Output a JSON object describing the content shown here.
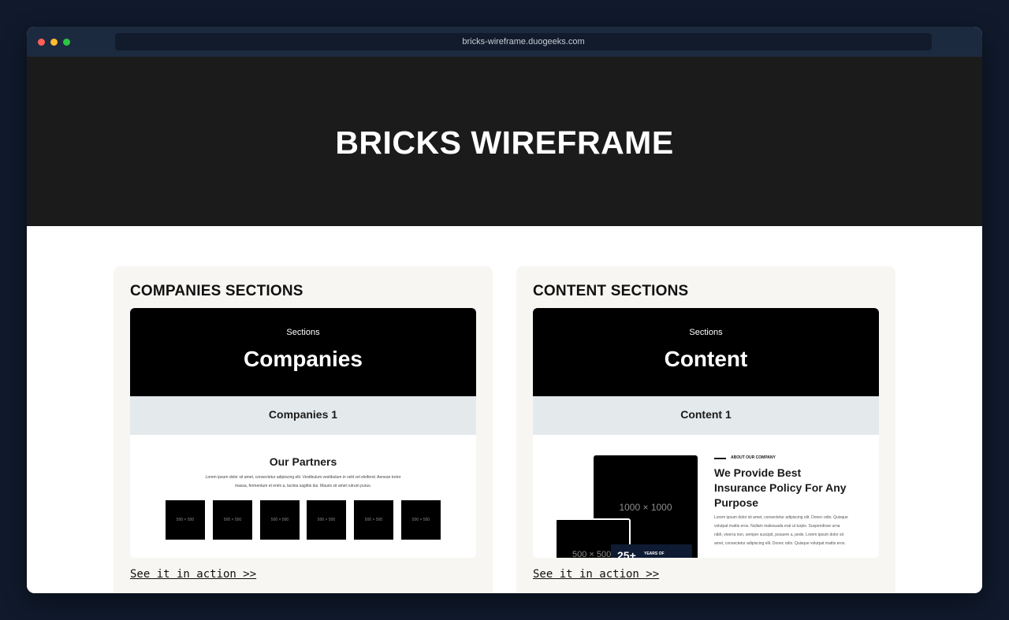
{
  "browser": {
    "url": "bricks-wireframe.duogeeks.com"
  },
  "hero": {
    "title": "BRICKS WIREFRAME"
  },
  "cards": [
    {
      "title": "COMPANIES SECTIONS",
      "preview": {
        "kicker": "Sections",
        "heading": "Companies",
        "band_label": "Companies 1",
        "body_title": "Our Partners",
        "body_text": "Lorem ipsum dolor sit amet, consectetur adipiscing elit. Vestibulum vestibulum in velit vel eleifend. Aenean tortor massa, fermentum et enim a, lacinia sagittis dui. Mauris sit amet rutrum purus.",
        "logos": [
          "500 × 500",
          "500 × 500",
          "500 × 500",
          "500 × 500",
          "500 × 500",
          "500 × 500"
        ]
      },
      "link": "See it in action >>"
    },
    {
      "title": "CONTENT SECTIONS",
      "preview": {
        "kicker": "Sections",
        "heading": "Content",
        "band_label": "Content 1",
        "big_image": "1000 × 1000",
        "small_image": "500 × 500",
        "years_number": "25+",
        "years_label": "YEARS OF",
        "about_kicker": "ABOUT OUR COMPANY",
        "about_title": "We Provide Best Insurance Policy For Any Purpose",
        "about_text": "Lorem ipsum dolor sit amet, consectetur adipiscing elit. Donec odio. Quisque volutpat mattis eros. Nullam malesuada erat ut turpis. Suspendisse urna nibh, viverra non, semper suscipit, posuere a, pede. Lorem ipsum dolor sit amet, consectetur adipiscing elit. Donec odio. Quisque volutpat mattis eros."
      },
      "link": "See it in action >>"
    }
  ]
}
